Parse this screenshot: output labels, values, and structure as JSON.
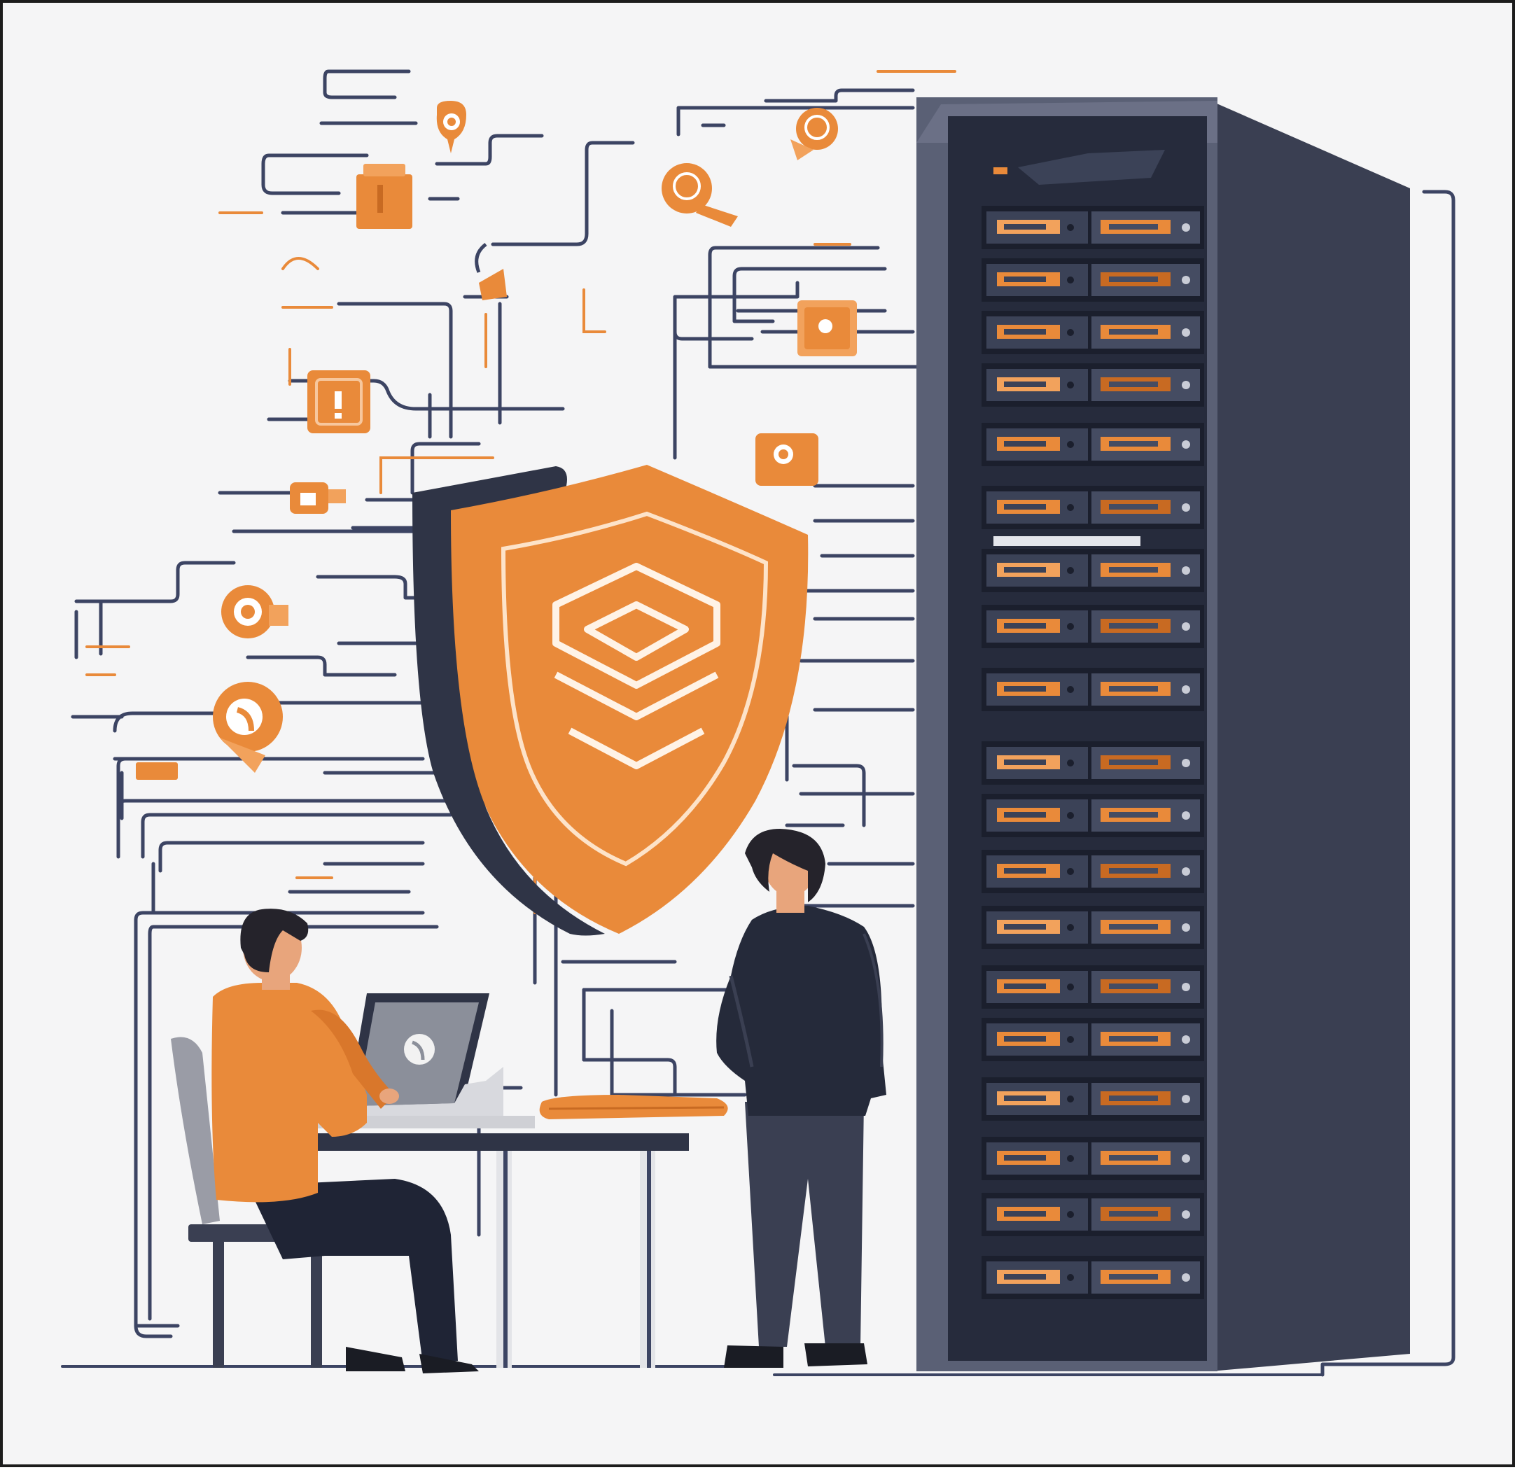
{
  "scene": {
    "subject": "illustration",
    "colors": {
      "orange": "#e98a3a",
      "orange_light": "#f2a25c",
      "orange_dark": "#c86a22",
      "navy": "#2a2f45",
      "rack_face": "#3b4257",
      "rack_side": "#5a6075",
      "line": "#3c4463",
      "skin": "#e8a57c",
      "hair": "#25232b",
      "background": "#f5f5f6"
    },
    "icons": [
      "shield-icon",
      "lock-icon",
      "alert-icon",
      "gear-icon",
      "camera-icon",
      "folder-icon",
      "key-icon",
      "cloud-icon",
      "chat-icon",
      "target-icon"
    ]
  }
}
